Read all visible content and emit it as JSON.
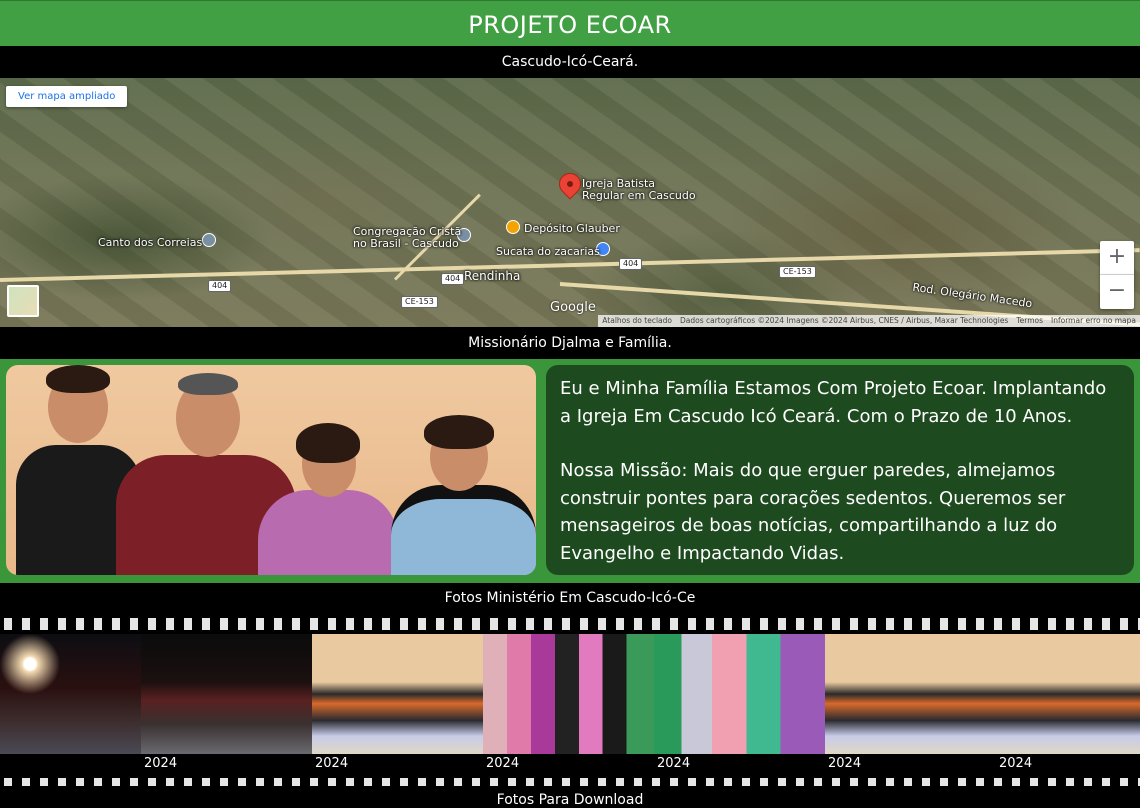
{
  "header": {
    "title": "PROJETO ECOAR"
  },
  "location_bar": {
    "text": "Cascudo-Icó-Ceará."
  },
  "map": {
    "enlarge_button": "Ver mapa ampliado",
    "zoom_in": "+",
    "zoom_out": "−",
    "google_logo": "Google",
    "pin_label_line1": "Igreja Batista",
    "pin_label_line2": "Regular em Cascudo",
    "poi_deposito": "Depósito Glauber",
    "poi_sucata": "Sucata do zacarias",
    "poi_congregacao_line1": "Congregação Cristã",
    "poi_congregacao_line2": "no Brasil - Cascudo",
    "poi_canto": "Canto dos Correias",
    "town": "Rendinha",
    "road_name": "Rod. Olegário Macedo",
    "shields": {
      "s1": "404",
      "s2": "404",
      "s3": "404",
      "s4": "CE-153",
      "s5": "CE-153"
    },
    "attribution": {
      "keyboard": "Atalhos do teclado",
      "data": "Dados cartográficos ©2024 Imagens ©2024 Airbus, CNES / Airbus, Maxar Technologies",
      "terms": "Termos",
      "report": "Informar erro no mapa"
    }
  },
  "family_bar": {
    "text": "Missionário Djalma e Família."
  },
  "family_text": {
    "p1": "Eu e Minha Família Estamos Com Projeto Ecoar. Implantando a Igreja Em Cascudo Icó Ceará. Com o Prazo de 10 Anos.",
    "p2": "Nossa Missão: Mais do que erguer paredes, almejamos construir pontes para corações sedentos. Queremos ser mensageiros de boas notícias, compartilhando a luz do Evangelho e Impactando Vidas."
  },
  "photos_bar": {
    "text": "Fotos Ministério Em Cascudo-Icó-Ce"
  },
  "gallery": {
    "captions": [
      "2024",
      "2024",
      "2024",
      "2024",
      "2024",
      "2024",
      "2024"
    ]
  },
  "download_bar": {
    "text": "Fotos Para Download"
  }
}
